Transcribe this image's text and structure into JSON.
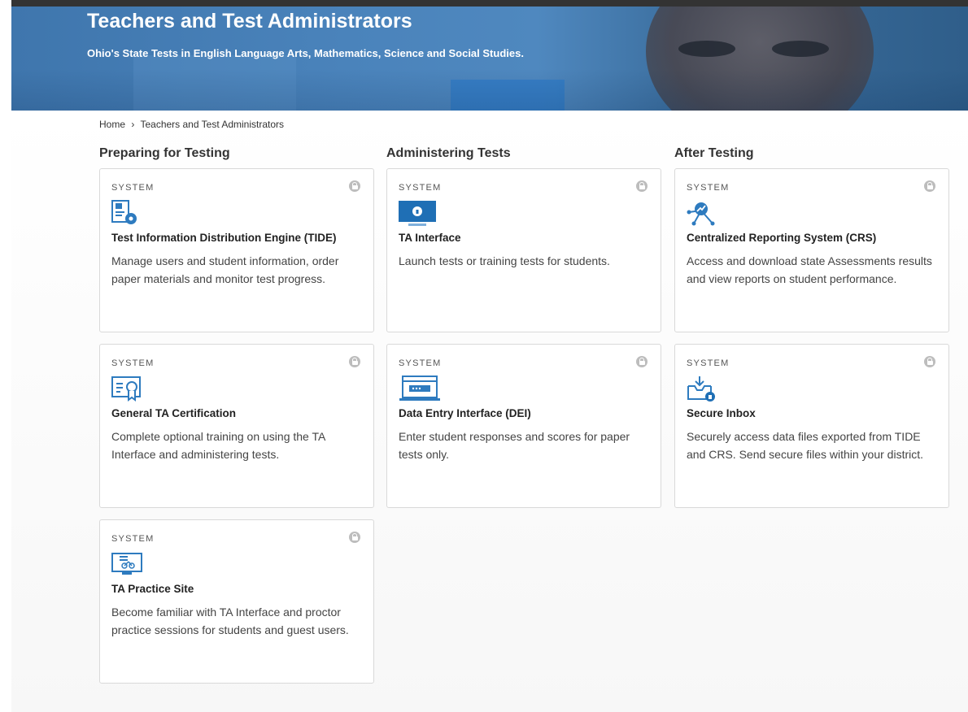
{
  "hero": {
    "title": "Teachers and Test Administrators",
    "subtitle": "Ohio's State Tests in English Language Arts, Mathematics, Science and Social Studies."
  },
  "breadcrumb": {
    "home": "Home",
    "separator": "›",
    "current": "Teachers and Test Administrators"
  },
  "columns": [
    {
      "heading": "Preparing for Testing"
    },
    {
      "heading": "Administering Tests"
    },
    {
      "heading": "After Testing"
    }
  ],
  "cards": {
    "tide": {
      "kind": "SYSTEM",
      "icon": "id-card-gear-icon",
      "title": "Test Information Distribution Engine (TIDE)",
      "desc": "Manage users and student information, order paper materials and monitor test progress."
    },
    "ta_interface": {
      "kind": "SYSTEM",
      "icon": "monitor-lock-icon",
      "title": "TA Interface",
      "desc": "Launch tests or training tests for students."
    },
    "crs": {
      "kind": "SYSTEM",
      "icon": "network-chart-icon",
      "title": "Centralized Reporting System (CRS)",
      "desc": "Access and download state Assessments results and view reports on student performance."
    },
    "certification": {
      "kind": "SYSTEM",
      "icon": "certificate-icon",
      "title": "General TA Certification",
      "desc": "Complete optional training on using the TA Interface and administering tests."
    },
    "dei": {
      "kind": "SYSTEM",
      "icon": "laptop-entry-icon",
      "title": "Data Entry Interface (DEI)",
      "desc": "Enter student responses and scores for paper tests only."
    },
    "inbox": {
      "kind": "SYSTEM",
      "icon": "inbox-lock-icon",
      "title": "Secure Inbox",
      "desc": "Securely access data files exported from TIDE and CRS. Send secure files within your district."
    },
    "practice": {
      "kind": "SYSTEM",
      "icon": "practice-monitor-icon",
      "title": "TA Practice Site",
      "desc": "Become familiar with TA Interface and proctor practice sessions for students and guest users."
    }
  },
  "colors": {
    "accent": "#2e7bbf",
    "hero": "#4a83bb",
    "lock": "#bdbdbd"
  }
}
